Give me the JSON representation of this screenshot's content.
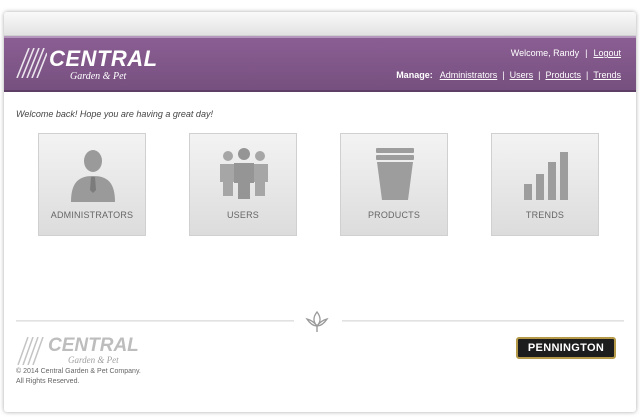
{
  "header": {
    "logo_word": "CENTRAL",
    "logo_sub": "Garden & Pet",
    "welcome_user": "Welcome, Randy",
    "logout": "Logout",
    "manage_label": "Manage:",
    "nav": [
      "Administrators",
      "Users",
      "Products",
      "Trends"
    ]
  },
  "main": {
    "welcome_message": "Welcome back! Hope you are having a great day!",
    "tiles": [
      {
        "label": "ADMINISTRATORS",
        "icon": "administrator-icon"
      },
      {
        "label": "USERS",
        "icon": "users-icon"
      },
      {
        "label": "PRODUCTS",
        "icon": "products-icon"
      },
      {
        "label": "TRENDS",
        "icon": "trends-icon"
      }
    ]
  },
  "footer": {
    "logo_word": "CENTRAL",
    "logo_sub": "Garden & Pet",
    "copyright_line1": "© 2014 Central Garden & Pet Company.",
    "copyright_line2": "All Rights Reserved.",
    "brand": "PENNINGTON"
  },
  "colors": {
    "header_purple": "#7f5789",
    "tile_gray": "#e8e8e8",
    "icon_gray": "#9a9a9a"
  }
}
